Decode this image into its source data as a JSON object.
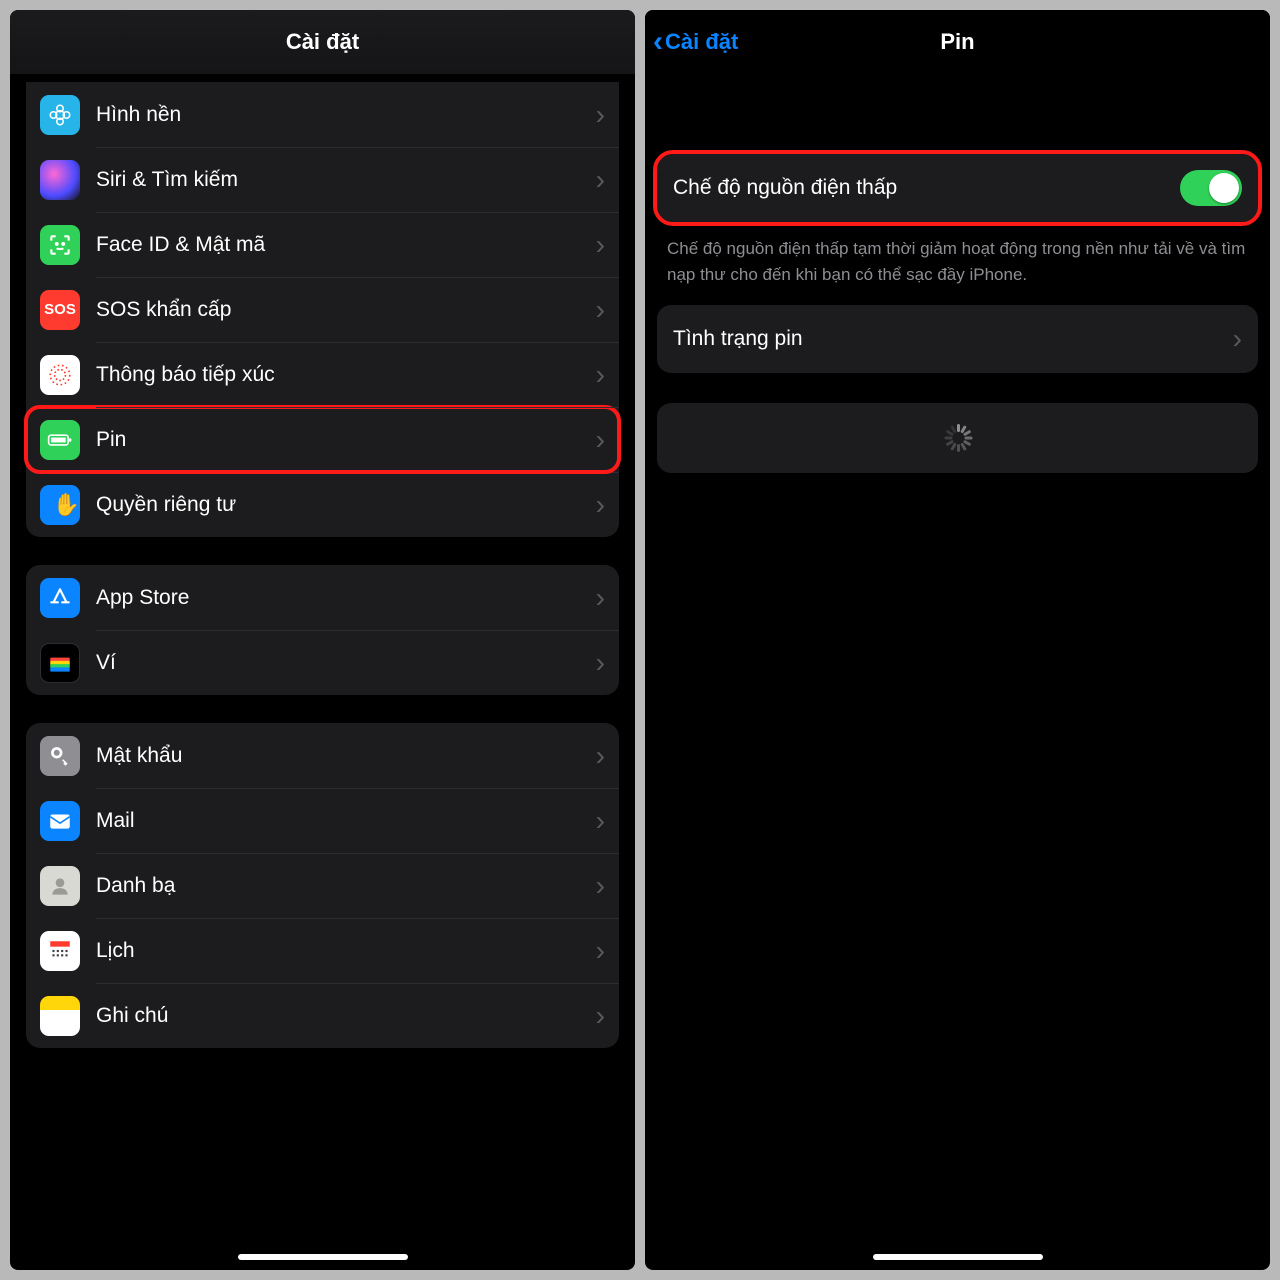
{
  "left": {
    "title": "Cài đặt",
    "group1": [
      {
        "key": "wallpaper",
        "label": "Hình nền"
      },
      {
        "key": "siri",
        "label": "Siri & Tìm kiếm"
      },
      {
        "key": "faceid",
        "label": "Face ID & Mật mã"
      },
      {
        "key": "sos",
        "label": "SOS khẩn cấp"
      },
      {
        "key": "exposure",
        "label": "Thông báo tiếp xúc"
      },
      {
        "key": "battery",
        "label": "Pin"
      },
      {
        "key": "privacy",
        "label": "Quyền riêng tư"
      }
    ],
    "group2": [
      {
        "key": "appstore",
        "label": "App Store"
      },
      {
        "key": "wallet",
        "label": "Ví"
      }
    ],
    "group3": [
      {
        "key": "passwords",
        "label": "Mật khẩu"
      },
      {
        "key": "mail",
        "label": "Mail"
      },
      {
        "key": "contacts",
        "label": "Danh bạ"
      },
      {
        "key": "calendar",
        "label": "Lịch"
      },
      {
        "key": "notes",
        "label": "Ghi chú"
      }
    ],
    "sos_text": "SOS"
  },
  "right": {
    "back": "Cài đặt",
    "title": "Pin",
    "low_power_label": "Chế độ nguồn điện thấp",
    "low_power_on": true,
    "description": "Chế độ nguồn điện thấp tạm thời giảm hoạt động trong nền như tải về và tìm nạp thư cho đến khi bạn có thể sạc đầy iPhone.",
    "battery_health": "Tình trạng pin"
  }
}
